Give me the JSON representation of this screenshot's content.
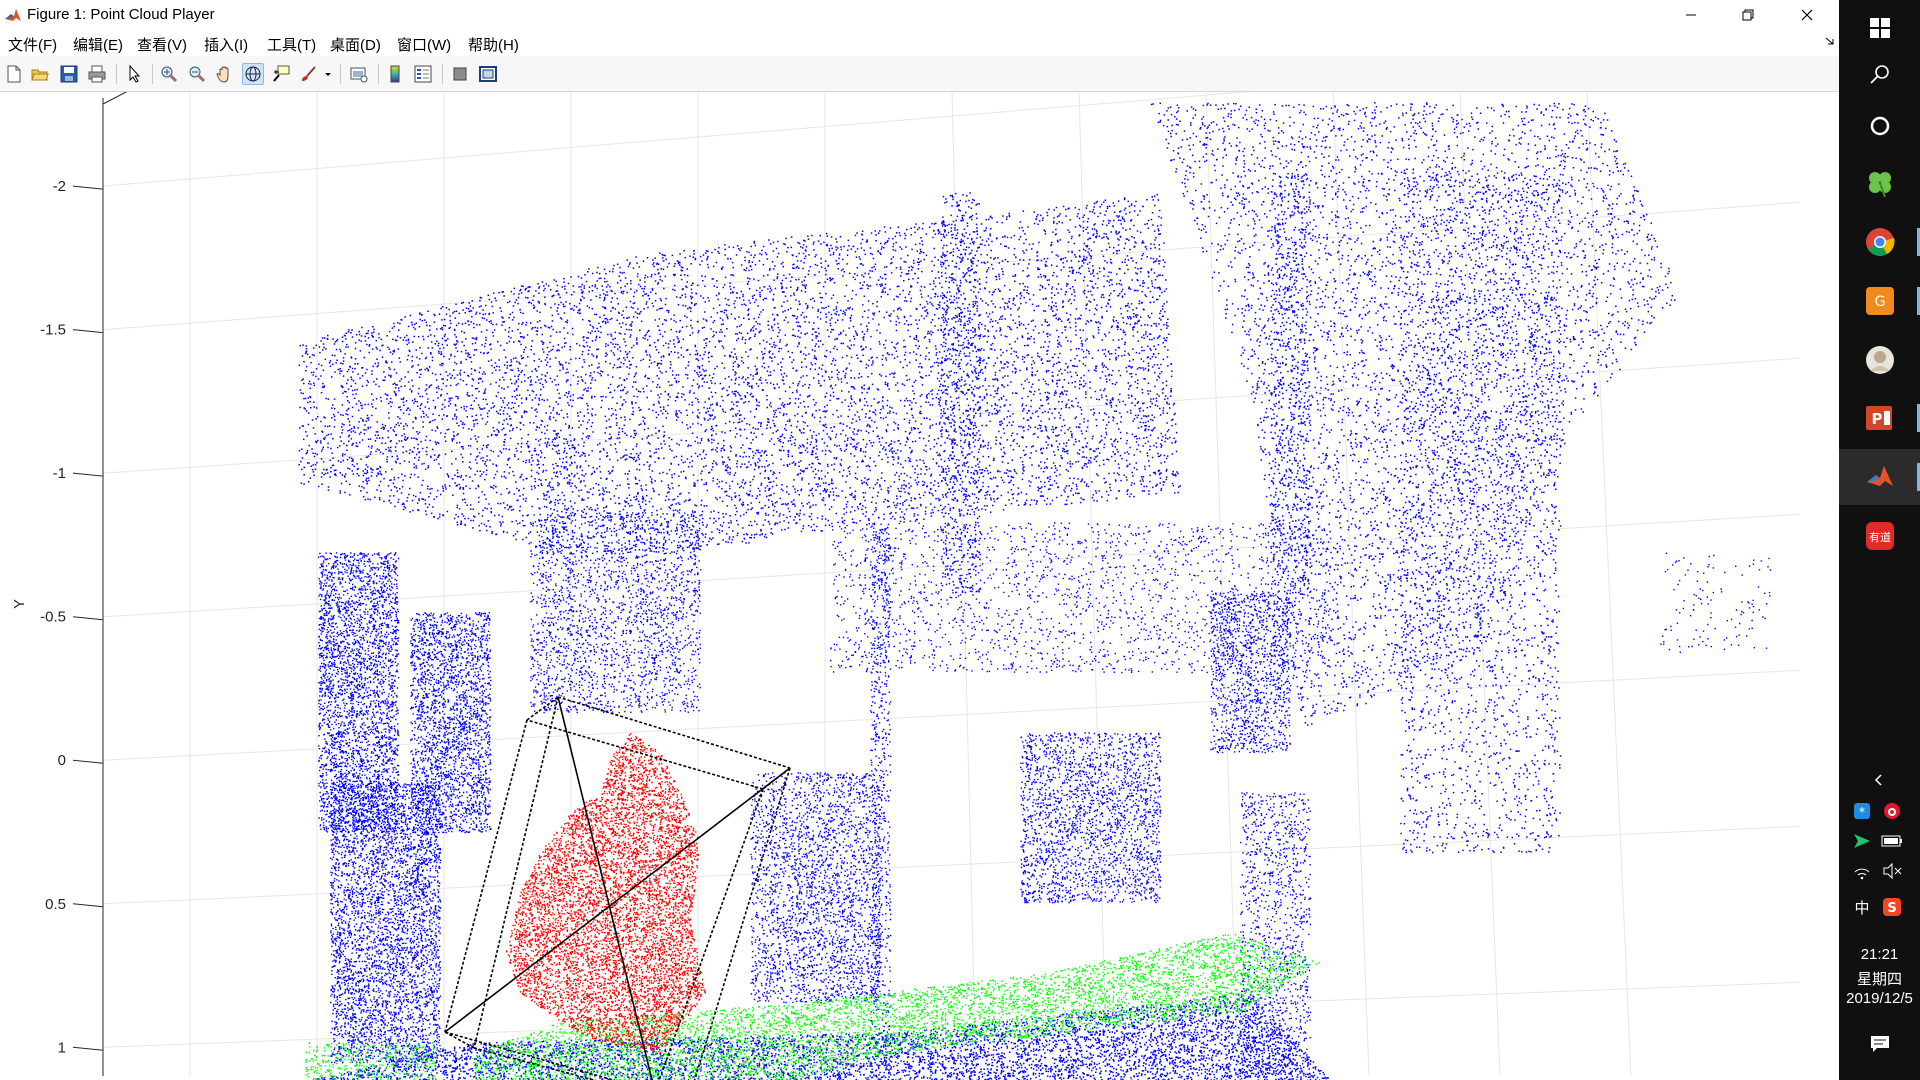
{
  "window": {
    "title": "Figure 1: Point Cloud Player"
  },
  "menu": [
    {
      "label": "文件(F)"
    },
    {
      "label": "编辑(E)"
    },
    {
      "label": "查看(V)"
    },
    {
      "label": "插入(I)"
    },
    {
      "label": "工具(T)"
    },
    {
      "label": "桌面(D)"
    },
    {
      "label": "窗口(W)"
    },
    {
      "label": "帮助(H)"
    }
  ],
  "toolbar": [
    {
      "icon": "new-figure-icon"
    },
    {
      "icon": "open-file-icon"
    },
    {
      "icon": "save-icon"
    },
    {
      "icon": "print-icon"
    },
    {
      "icon": "edit-plot-arrow-icon"
    },
    {
      "icon": "zoom-in-icon"
    },
    {
      "icon": "zoom-out-icon"
    },
    {
      "icon": "pan-hand-icon"
    },
    {
      "icon": "rotate-3d-icon"
    },
    {
      "icon": "data-cursor-icon"
    },
    {
      "icon": "brush-icon"
    },
    {
      "icon": "link-plot-icon"
    },
    {
      "icon": "insert-colorbar-icon"
    },
    {
      "icon": "insert-legend-icon"
    },
    {
      "icon": "hide-plot-tools-icon"
    },
    {
      "icon": "show-plot-tools-icon"
    }
  ],
  "chart_data": {
    "type": "scatter",
    "ylabel": "Y",
    "y_ticks": [
      "-2",
      "-1.5",
      "-1",
      "-0.5",
      "0",
      "0.5",
      "1"
    ],
    "y_tick_values": [
      -2,
      -1.5,
      -1,
      -0.5,
      0,
      0.5,
      1
    ],
    "ylim": [
      -2.3,
      1.1
    ],
    "y_reversed": true,
    "grid": true,
    "view": "3d",
    "series": [
      {
        "color": "#0000ff",
        "role": "background"
      },
      {
        "color": "#ff0000",
        "role": "segmented-object"
      },
      {
        "color": "#00ff00",
        "role": "ground-plane"
      }
    ],
    "bounding_box_color": "#000000"
  },
  "taskbar": {
    "apps": [
      {
        "icon": "start-windows-icon"
      },
      {
        "icon": "search-icon"
      },
      {
        "icon": "cortana-circle-icon"
      },
      {
        "icon": "clover-app-icon"
      },
      {
        "icon": "chrome-icon"
      },
      {
        "icon": "pdf-reader-icon"
      },
      {
        "icon": "avatar-app-icon"
      },
      {
        "icon": "powerpoint-icon"
      },
      {
        "icon": "matlab-icon"
      },
      {
        "icon": "youdao-icon"
      }
    ],
    "youdao_label": "有道",
    "clock": {
      "time": "21:21",
      "weekday": "星期四",
      "date": "2019/12/5"
    },
    "ime_label": "中"
  }
}
